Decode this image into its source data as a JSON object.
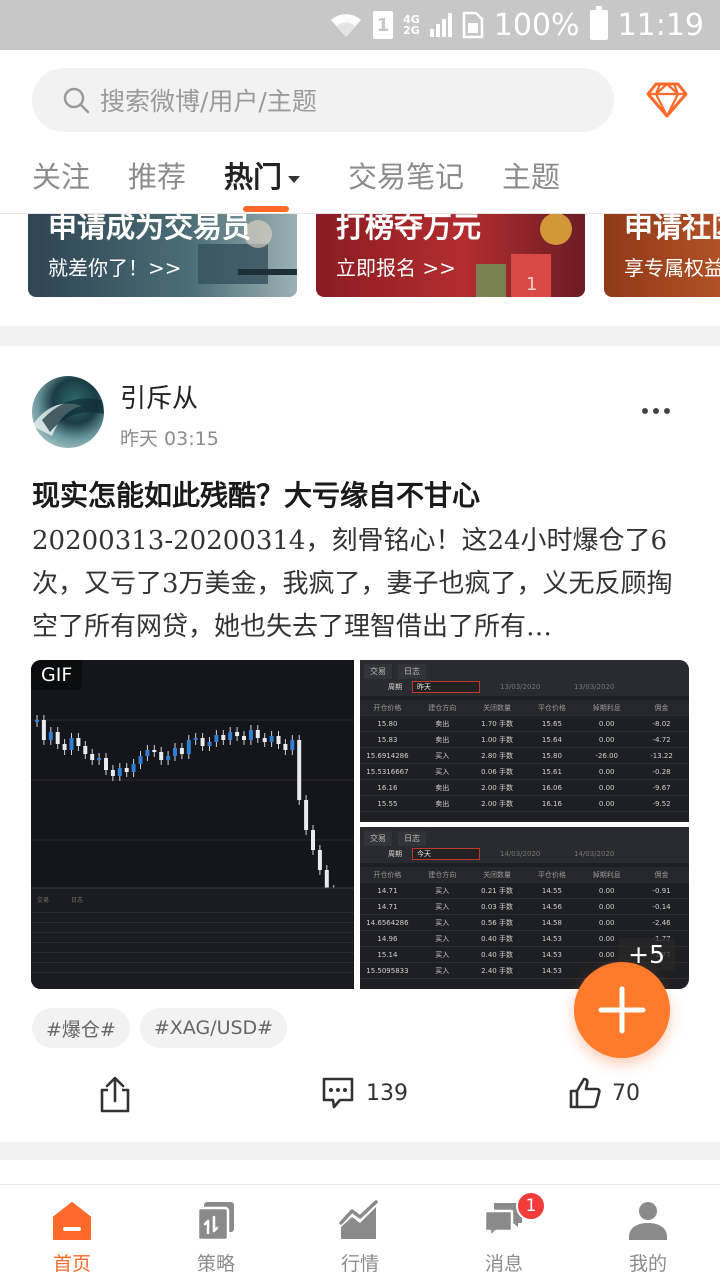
{
  "status_bar": {
    "network_top": "4G",
    "network_bottom": "2G",
    "sim": "1",
    "battery": "100%",
    "time": "11:19"
  },
  "search": {
    "placeholder": "搜索微博/用户/主题"
  },
  "tabs": [
    {
      "label": "关注"
    },
    {
      "label": "推荐"
    },
    {
      "label": "热门"
    },
    {
      "label": "交易笔记"
    },
    {
      "label": "主题"
    }
  ],
  "banners": [
    {
      "title": "申请成为交易员",
      "subtitle": "就差你了！>>"
    },
    {
      "title": "打榜夺万元",
      "subtitle": "立即报名 >>"
    },
    {
      "title": "申请社区",
      "subtitle": "享专属权益"
    }
  ],
  "post": {
    "author": "引斥从",
    "time": "昨天 03:15",
    "title": "现实怎能如此残酷？大亏缘自不甘心",
    "body": "20200313-20200314，刻骨铭心！这24小时爆仓了6次，又亏了3万美金，我疯了，妻子也疯了，义无反顾掏空了所有网贷，她也失去了理智借出了所有…",
    "gif_label": "GIF",
    "more_images": "+5",
    "tags": [
      "#爆仓#",
      "#XAG/USD#"
    ],
    "comments": "139",
    "likes": "70"
  },
  "table_top": {
    "tabs": [
      "交易",
      "日志"
    ],
    "filter_label": "周期",
    "filter_value": "昨天",
    "date_from": "13/03/2020",
    "date_to": "13/03/2020",
    "headers": [
      "开仓价格",
      "建仓方向",
      "关闭数量",
      "平仓价格",
      "掉期利息",
      "佣金"
    ],
    "rows": [
      [
        "15.80",
        "卖出",
        "1.70 手数",
        "15.65",
        "0.00",
        "-8.02"
      ],
      [
        "15.83",
        "卖出",
        "1.00 手数",
        "15.64",
        "0.00",
        "-4.72"
      ],
      [
        "15.6914286",
        "买入",
        "2.80 手数",
        "15.80",
        "-26.00",
        "-13.22"
      ],
      [
        "15.5316667",
        "买入",
        "0.06 手数",
        "15.61",
        "0.00",
        "-0.28"
      ],
      [
        "16.16",
        "卖出",
        "2.00 手数",
        "16.06",
        "0.00",
        "-9.67"
      ],
      [
        "15.55",
        "卖出",
        "2.00 手数",
        "16.16",
        "0.00",
        "-9.52"
      ]
    ]
  },
  "table_bottom": {
    "tabs": [
      "交易",
      "日志"
    ],
    "filter_label": "周期",
    "filter_value": "今天",
    "date_from": "14/03/2020",
    "date_to": "14/03/2020",
    "headers": [
      "开仓价格",
      "建仓方向",
      "关闭数量",
      "平仓价格",
      "掉期利息",
      "佣金"
    ],
    "rows": [
      [
        "14.71",
        "买入",
        "0.21 手数",
        "14.55",
        "0.00",
        "-0.91"
      ],
      [
        "14.71",
        "买入",
        "0.03 手数",
        "14.56",
        "0.00",
        "-0.14"
      ],
      [
        "14.6564286",
        "买入",
        "0.56 手数",
        "14.58",
        "0.00",
        "-2.46"
      ],
      [
        "14.96",
        "买入",
        "0.40 手数",
        "14.53",
        "0.00",
        "-1.77"
      ],
      [
        "15.14",
        "买入",
        "0.40 手数",
        "14.53",
        "0.00",
        "-1.77"
      ],
      [
        "15.5095833",
        "买入",
        "2.40 手数",
        "14.53",
        "0.00",
        ""
      ]
    ]
  },
  "bottom_nav": [
    {
      "label": "首页",
      "icon": "home-icon",
      "active": true
    },
    {
      "label": "策略",
      "icon": "strategy-icon",
      "active": false
    },
    {
      "label": "行情",
      "icon": "market-icon",
      "active": false
    },
    {
      "label": "消息",
      "icon": "message-icon",
      "active": false,
      "badge": "1"
    },
    {
      "label": "我的",
      "icon": "profile-icon",
      "active": false
    }
  ],
  "colors": {
    "accent": "#ff6a2a",
    "badge": "#f23b3b"
  }
}
